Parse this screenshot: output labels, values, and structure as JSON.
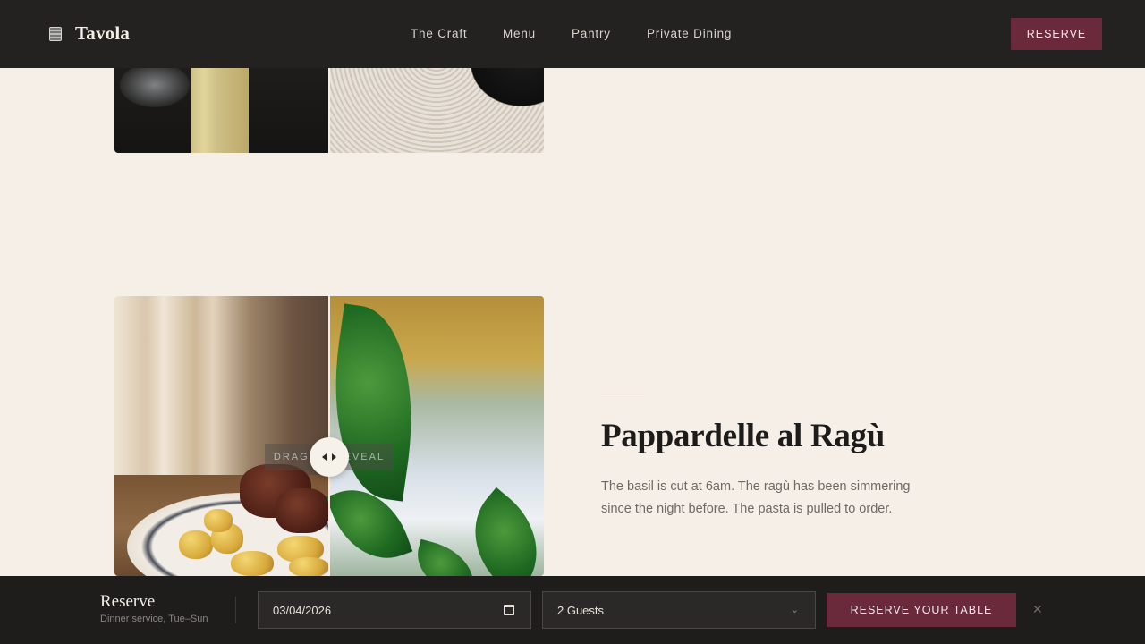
{
  "header": {
    "brand": "Tavola",
    "nav": [
      "The Craft",
      "Menu",
      "Pantry",
      "Private Dining"
    ],
    "reserve_label": "RESERVE",
    "accent_color": "#6a2a3c"
  },
  "slider": {
    "label": "DRAG TO REVEAL",
    "handle_icon": "left-right-arrows-icon"
  },
  "dish": {
    "title": "Pappardelle al Ragù",
    "description": "The basil is cut at 6am. The ragù has been simmering since the night before. The pasta is pulled to order."
  },
  "reserve_bar": {
    "title": "Reserve",
    "subtitle": "Dinner service, Tue–Sun",
    "date_value": "03/04/2026",
    "guests_value": "2 Guests",
    "submit_label": "RESERVE YOUR TABLE",
    "close_icon": "close-icon"
  }
}
